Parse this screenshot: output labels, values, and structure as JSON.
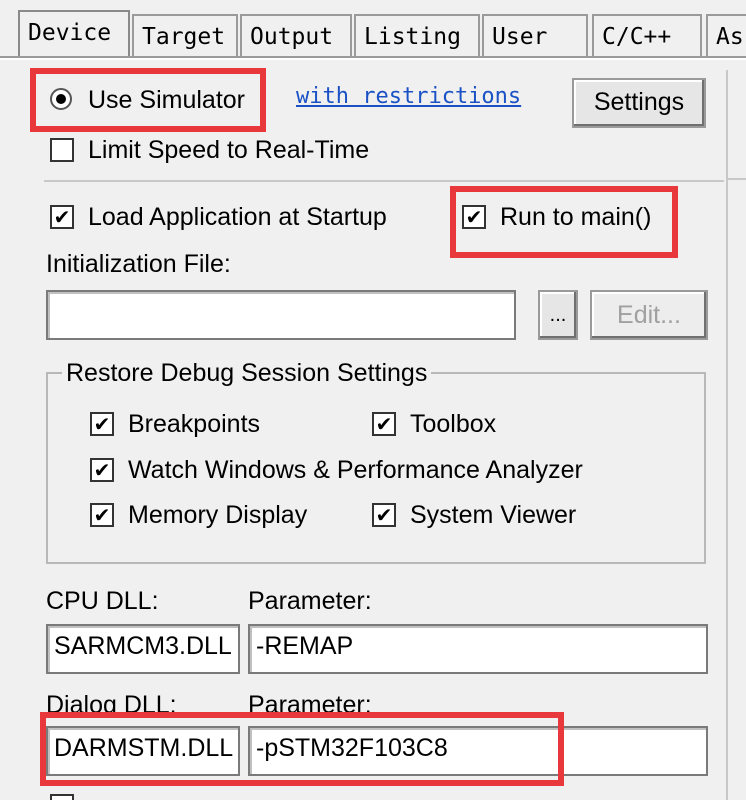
{
  "tabs": [
    {
      "label": "Device"
    },
    {
      "label": "Target"
    },
    {
      "label": "Output"
    },
    {
      "label": "Listing"
    },
    {
      "label": "User"
    },
    {
      "label": "C/C++"
    },
    {
      "label": "As"
    }
  ],
  "simulator": {
    "use_label": "Use Simulator",
    "use_checked": true,
    "restrictions_link": "with restrictions",
    "settings_label": "Settings",
    "limit_speed_label": "Limit Speed to Real-Time",
    "limit_speed_checked": false
  },
  "startup": {
    "load_app_label": "Load Application at Startup",
    "load_app_checked": true,
    "run_to_main_label": "Run to main()",
    "run_to_main_checked": true,
    "init_file_label": "Initialization File:",
    "init_file_value": "",
    "browse_label": "...",
    "edit_label": "Edit..."
  },
  "restore": {
    "title": "Restore Debug Session Settings",
    "breakpoints_label": "Breakpoints",
    "toolbox_label": "Toolbox",
    "watch_label": "Watch Windows & Performance Analyzer",
    "memory_label": "Memory Display",
    "system_viewer_label": "System Viewer"
  },
  "dll": {
    "cpu_dll_label": "CPU DLL:",
    "cpu_param_label": "Parameter:",
    "cpu_dll_value": "SARMCM3.DLL",
    "cpu_param_value": "-REMAP",
    "dialog_dll_label": "Dialog DLL:",
    "dialog_param_label": "Parameter:",
    "dialog_dll_value": "DARMSTM.DLL",
    "dialog_param_value": "-pSTM32F103C8"
  },
  "colors": {
    "highlight": "#e8383b",
    "link": "#1a52c5",
    "background": "#f0f0f0"
  },
  "check_glyph": "✔"
}
